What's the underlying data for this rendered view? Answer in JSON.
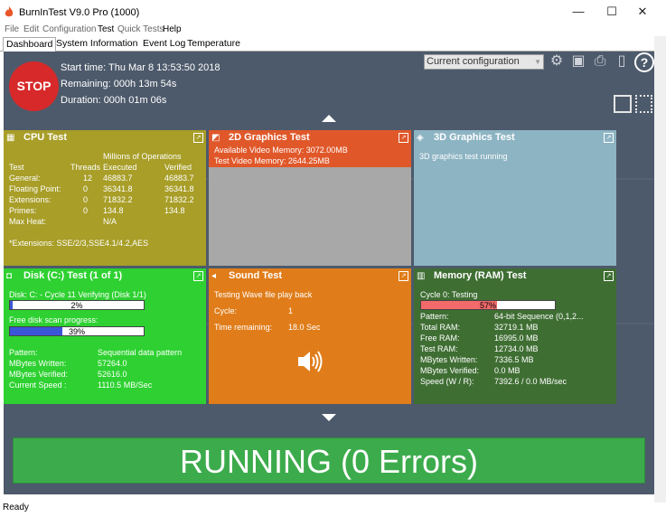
{
  "window": {
    "title": "BurnInTest V9.0 Pro (1000)",
    "minimize": "—",
    "maximize": "☐",
    "close": "✕"
  },
  "menu": [
    "File",
    "Edit",
    "Configuration",
    "Test",
    "Quick Tests",
    "Help"
  ],
  "tabs": [
    "Dashboard",
    "System Information",
    "Event Log",
    "Temperature"
  ],
  "header": {
    "stop_label": "STOP",
    "start_time": "Start time: Thu Mar  8 13:53:50 2018",
    "remaining": "Remaining: 000h 13m 54s",
    "duration": "Duration: 000h 01m 06s",
    "config_select": "Current configuration",
    "icons": [
      "gear-icon",
      "save-icon",
      "print-icon",
      "clipboard-icon",
      "help-icon"
    ]
  },
  "cpu": {
    "title": "CPU Test",
    "millions_header": "Millions of Operations",
    "col_test": "Test",
    "col_threads": "Threads",
    "col_executed": "Executed",
    "col_verified": "Verified",
    "rows": [
      {
        "name": "General:",
        "threads": "12",
        "executed": "46883.7",
        "verified": "46883.7"
      },
      {
        "name": "Floating Point:",
        "threads": "0",
        "executed": "36341.8",
        "verified": "36341.8"
      },
      {
        "name": "Extensions:",
        "threads": "0",
        "executed": "71832.2",
        "verified": "71832.2"
      },
      {
        "name": "Primes:",
        "threads": "0",
        "executed": "134.8",
        "verified": "134.8"
      },
      {
        "name": "Max Heat:",
        "threads": "",
        "executed": "N/A",
        "verified": ""
      }
    ],
    "extensions": "*Extensions: SSE/2/3,SSE4.1/4.2,AES",
    "color": "#a89e28"
  },
  "gfx2d": {
    "title": "2D Graphics Test",
    "line1": "Available Video Memory: 3072.00MB",
    "line2": "Test Video Memory: 2644.25MB",
    "color": "#e0582a"
  },
  "gfx3d": {
    "title": "3D Graphics Test",
    "line1": "3D graphics test running",
    "color": "#8db4c3"
  },
  "disk": {
    "title": "Disk (C:) Test (1 of 1)",
    "status": "Disk: C: - Cycle 11 Verifying (Disk 1/1)",
    "progress_label": "2%",
    "progress_value": 2,
    "scan_label": "Free disk scan progress:",
    "scan_progress_label": "39%",
    "scan_progress_value": 39,
    "pattern_label": "Pattern:",
    "pattern": "Sequential data pattern",
    "written_label": "MBytes Written:",
    "written": "57264.0",
    "verified_label": "MBytes Verified:",
    "verified": "52616.0",
    "speed_label": "Current Speed :",
    "speed": "1110.5 MB/Sec",
    "color": "#2ed131"
  },
  "sound": {
    "title": "Sound Test",
    "line1": "Testing Wave file play back",
    "cycle_label": "Cycle:",
    "cycle": "1",
    "time_label": "Time remaining:",
    "time": "18.0 Sec",
    "color": "#e07d1a"
  },
  "memory": {
    "title": "Memory (RAM) Test",
    "cycle": "Cycle 0: Testing",
    "progress_label": "57%",
    "progress_value": 57,
    "rows": [
      {
        "label": "Pattern:",
        "value": "64-bit Sequence (0,1,2..."
      },
      {
        "label": "Total RAM:",
        "value": "32719.1 MB"
      },
      {
        "label": "Free RAM:",
        "value": "16995.0 MB"
      },
      {
        "label": "Test RAM:",
        "value": "12734.0 MB"
      },
      {
        "label": "MBytes Written:",
        "value": "7336.5 MB"
      },
      {
        "label": "MBytes Verified:",
        "value": "0.0 MB"
      },
      {
        "label": "Speed (W / R):",
        "value": "7392.6 / 0.0  MB/sec"
      }
    ],
    "color": "#3f6e33"
  },
  "status_banner": "RUNNING (0 Errors)",
  "statusbar": "Ready"
}
